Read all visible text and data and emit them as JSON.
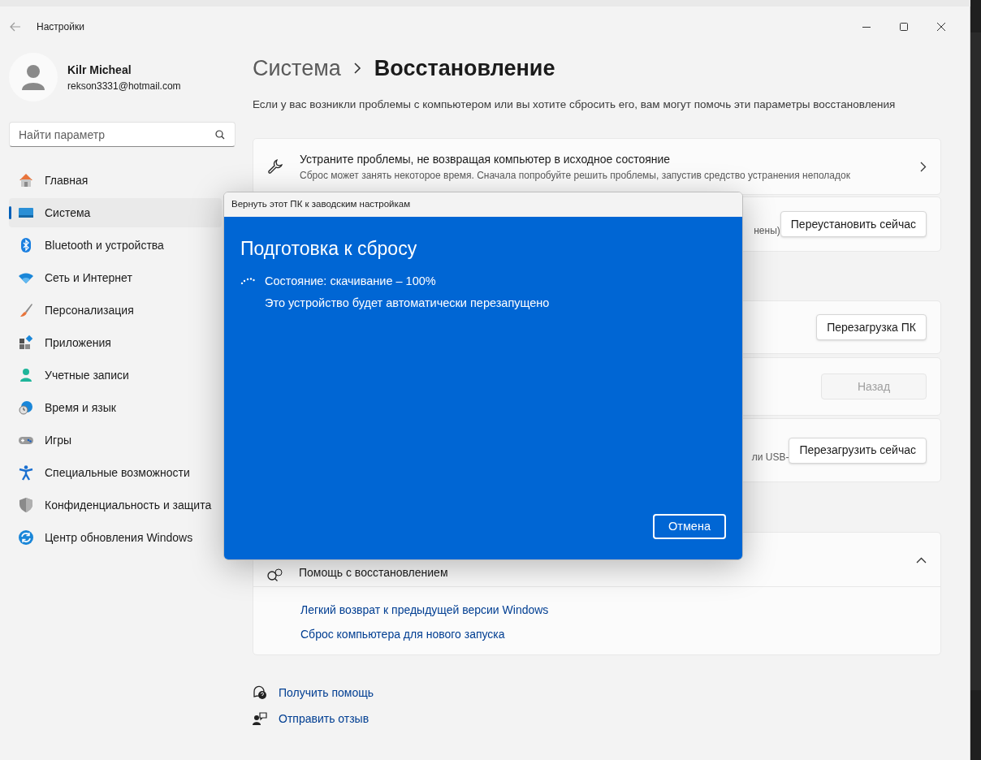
{
  "window": {
    "title": "Настройки"
  },
  "user": {
    "name": "Kilr Micheal",
    "email": "rekson3331@hotmail.com"
  },
  "search": {
    "placeholder": "Найти параметр"
  },
  "sidebar": {
    "items": [
      {
        "label": "Главная",
        "selected": false
      },
      {
        "label": "Система",
        "selected": true
      },
      {
        "label": "Bluetooth и устройства",
        "selected": false
      },
      {
        "label": "Сеть и Интернет",
        "selected": false
      },
      {
        "label": "Персонализация",
        "selected": false
      },
      {
        "label": "Приложения",
        "selected": false
      },
      {
        "label": "Учетные записи",
        "selected": false
      },
      {
        "label": "Время и язык",
        "selected": false
      },
      {
        "label": "Игры",
        "selected": false
      },
      {
        "label": "Специальные возможности",
        "selected": false
      },
      {
        "label": "Конфиденциальность и защита",
        "selected": false
      },
      {
        "label": "Центр обновления Windows",
        "selected": false
      }
    ]
  },
  "breadcrumb": [
    "Система",
    "Восстановление"
  ],
  "description": "Если у вас возникли проблемы с компьютером или вы хотите сбросить его, вам могут помочь эти параметры восстановления",
  "cards": [
    {
      "kind": "nav",
      "title": "Устраните проблемы, не возвращая компьютер в исходное состояние",
      "subtitle": "Сброс может занять некоторое время. Сначала попробуйте решить проблемы, запустив средство устранения неполадок"
    },
    {
      "kind": "action",
      "fragment": "нены)",
      "button": {
        "label": "Переустановить сейчас",
        "disabled": false
      }
    },
    {
      "kind": "action",
      "button": {
        "label": "Перезагрузка ПК",
        "disabled": false
      }
    },
    {
      "kind": "action",
      "button": {
        "label": "Назад",
        "disabled": true
      }
    },
    {
      "kind": "action",
      "fragment": "ли USB-",
      "button": {
        "label": "Перезагрузить сейчас",
        "disabled": false
      }
    }
  ],
  "help": {
    "title": "Помощь с восстановлением",
    "expanded": true,
    "links": [
      "Легкий возврат к предыдущей версии Windows",
      "Сброс компьютера для нового запуска"
    ]
  },
  "footer_links": [
    {
      "kind": "help",
      "label": "Получить помощь"
    },
    {
      "kind": "feedback",
      "label": "Отправить отзыв"
    }
  ],
  "dialog": {
    "title": "Вернуть этот ПК к заводским настройкам",
    "heading": "Подготовка к сбросу",
    "status": "Состояние: скачивание – 100%",
    "note": "Это устройство будет автоматически перезапущено",
    "button": "Отмена"
  }
}
